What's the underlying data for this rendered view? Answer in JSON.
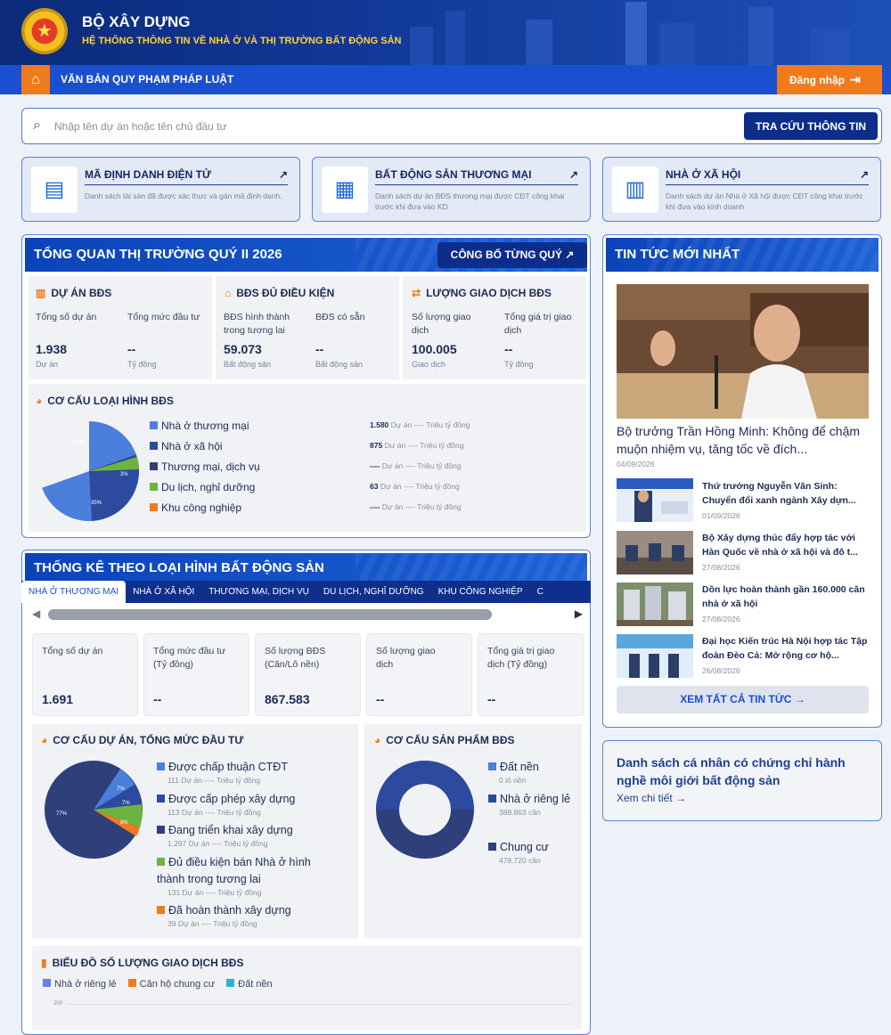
{
  "header": {
    "title": "BỘ XÂY DỰNG",
    "subtitle": "HỆ THỐNG THÔNG TIN VỀ NHÀ Ở VÀ THỊ TRƯỜNG BẤT ĐỘNG SẢN",
    "emblem_icon": "national-emblem-icon"
  },
  "nav": {
    "home_icon": "home-icon",
    "item": "VĂN BẢN QUY PHẠM PHÁP LUẬT",
    "login": "Đăng nhập",
    "login_icon": "login-icon"
  },
  "search": {
    "placeholder": "Nhập tên dự án hoặc tên chủ đầu tư",
    "button": "TRA CỨU THÔNG TIN"
  },
  "cards": [
    {
      "title": "MÃ ĐỊNH DANH ĐIỆN TỬ",
      "desc": "Danh sách tài sản đã được xác thực và gán mã định danh."
    },
    {
      "title": "BẤT ĐỘNG SẢN THƯƠNG MẠI",
      "desc": "Danh sách dự án BĐS thương mại được CĐT công khai trước khi đưa vào KD"
    },
    {
      "title": "NHÀ Ở XÃ HỘI",
      "desc": "Danh sách dự án Nhà ở Xã hội được CĐT công khai trước khi đưa vào kinh doanh"
    }
  ],
  "overview": {
    "title": "TỔNG QUAN THỊ TRƯỜNG QUÝ II 2026",
    "publish_btn": "CÔNG BỐ TỪNG QUÝ",
    "groups": [
      {
        "title": "DỰ ÁN BĐS",
        "items": [
          {
            "label": "Tổng số dự án",
            "value": "1.938",
            "unit": "Dự án"
          },
          {
            "label": "Tổng mức đầu tư",
            "value": "--",
            "unit": "Tỷ đồng"
          }
        ]
      },
      {
        "title": "BĐS ĐỦ ĐIỀU KIỆN",
        "items": [
          {
            "label": "BĐS hình thành trong tương lai",
            "value": "59.073",
            "unit": "Bất động sản"
          },
          {
            "label": "BĐS có sẵn",
            "value": "--",
            "unit": "Bất động sản"
          }
        ]
      },
      {
        "title": "LƯỢNG GIAO DỊCH BĐS",
        "items": [
          {
            "label": "Số lượng giao dịch",
            "value": "100.005",
            "unit": "Giao dịch"
          },
          {
            "label": "Tổng giá trị giao dịch",
            "value": "--",
            "unit": "Tỷ đồng"
          }
        ]
      }
    ],
    "structure_title": "CƠ CẤU LOẠI HÌNH BĐS",
    "legend": [
      {
        "name": "Nhà ở thương mại",
        "color": "#4a7fdb",
        "count": "1.580",
        "count_unit": "Dự án",
        "value": "----",
        "value_unit": "Triệu tỷ đồng"
      },
      {
        "name": "Nhà ở xã hội",
        "color": "#2c4a9e",
        "count": "875",
        "count_unit": "Dự án",
        "value": "----",
        "value_unit": "Triệu tỷ đồng"
      },
      {
        "name": "Thương mại, dịch vụ",
        "color": "#2f3f7a",
        "count": "----",
        "count_unit": "Dự án",
        "value": "----",
        "value_unit": "Triệu tỷ đồng"
      },
      {
        "name": "Du lịch, nghỉ dưỡng",
        "color": "#6db33f",
        "count": "63",
        "count_unit": "Dự án",
        "value": "----",
        "value_unit": "Triệu tỷ đồng"
      },
      {
        "name": "Khu công nghiệp",
        "color": "#f07b1d",
        "count": "----",
        "count_unit": "Dự án",
        "value": "----",
        "value_unit": "Triệu tỷ đồng"
      }
    ],
    "pie_labels": [
      "63%",
      "35%",
      "3%"
    ]
  },
  "stats": {
    "title": "THỐNG KÊ THEO LOẠI HÌNH BẤT ĐỘNG SẢN",
    "tabs": [
      "NHÀ Ở THƯƠNG MẠI",
      "NHÀ Ở XÃ HỘI",
      "THƯƠNG MẠI, DỊCH VỤ",
      "DU LỊCH, NGHỈ DƯỠNG",
      "KHU CÔNG NGHIỆP",
      "C"
    ],
    "boxes": [
      {
        "label": "Tổng số dự án",
        "value": "1.691"
      },
      {
        "label": "Tổng mức đầu tư (Tỷ đồng)",
        "value": "--"
      },
      {
        "label": "Số lượng BĐS (Căn/Lô nền)",
        "value": "867.583"
      },
      {
        "label": "Số lượng giao dịch",
        "value": "--"
      },
      {
        "label": "Tổng giá trị giao dịch (Tỷ đồng)",
        "value": "--"
      }
    ],
    "invest_title": "CƠ CẤU DỰ ÁN, TỔNG MỨC ĐẦU TƯ",
    "invest_legend": [
      {
        "name": "Được chấp thuận CTĐT",
        "sub": "111 Dự án ---- Triệu tỷ đồng",
        "color": "#4a7fdb"
      },
      {
        "name": "Được cấp phép xây dựng",
        "sub": "113 Dự án ---- Triệu tỷ đồng",
        "color": "#2c4a9e"
      },
      {
        "name": "Đang triển khai xây dựng",
        "sub": "1.297 Dự án ---- Triệu tỷ đồng",
        "color": "#2f3f7a"
      },
      {
        "name": "Đủ điều kiện bán Nhà ở hình thành trong tương lai",
        "sub": "131 Dự án ---- Triệu tỷ đồng",
        "color": "#6db33f"
      },
      {
        "name": "Đã hoàn thành xây dựng",
        "sub": "39 Dự án ---- Triệu tỷ đồng",
        "color": "#f07b1d"
      }
    ],
    "invest_pie_labels": [
      "77%",
      "7%",
      "7%",
      "8%"
    ],
    "product_title": "CƠ CẤU SẢN PHẨM BĐS",
    "product_legend": [
      {
        "name": "Đất nền",
        "sub": "0 lô nền",
        "color": "#4a7fdb"
      },
      {
        "name": "Nhà ở riêng lẻ",
        "sub": "388.863 căn",
        "color": "#2c4a9e"
      },
      {
        "name": "Chung cư",
        "sub": "478.720 căn",
        "color": "#2f3f7a"
      }
    ],
    "tx_title": "BIỂU ĐỒ SỐ LƯỢNG GIAO DỊCH BĐS",
    "tx_legend": [
      "Nhà ở riêng lẻ",
      "Căn hộ chung cư",
      "Đất nền"
    ],
    "tx_tick": "200"
  },
  "news": {
    "title": "TIN TỨC MỚI NHẤT",
    "main": {
      "title": "Bộ trưởng Trần Hồng Minh: Không để chậm muộn nhiệm vụ, tăng tốc về đích...",
      "date": "04/09/2026"
    },
    "items": [
      {
        "title": "Thứ trưởng Nguyễn Văn Sinh: Chuyển đổi xanh ngành Xây dựn...",
        "date": "01/09/2026"
      },
      {
        "title": "Bộ Xây dựng thúc đẩy hợp tác với Hàn Quốc về nhà ở xã hội và đô t...",
        "date": "27/08/2026"
      },
      {
        "title": "Dồn lực hoàn thành gần 160.000 căn nhà ở xã hội",
        "date": "27/08/2026"
      },
      {
        "title": "Đại học Kiến trúc Hà Nội hợp tác Tập đoàn Đèo Cả: Mở rộng cơ hộ...",
        "date": "26/08/2026"
      }
    ],
    "all": "XEM TẤT CẢ TIN TỨC"
  },
  "broker": {
    "title": "Danh sách cá nhân có chứng chỉ hành nghề môi giới bất động sản",
    "link": "Xem chi tiết"
  }
}
